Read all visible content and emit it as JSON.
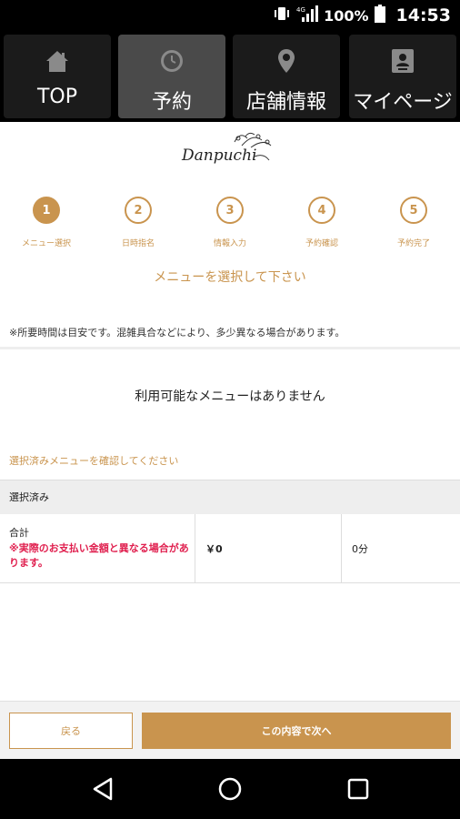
{
  "status_bar": {
    "network": "4G",
    "battery": "100%",
    "time": "14:53"
  },
  "nav": {
    "tabs": [
      {
        "label": "TOP",
        "icon": "home-icon",
        "active": false
      },
      {
        "label": "予約",
        "icon": "clock-icon",
        "active": true
      },
      {
        "label": "店舗情報",
        "icon": "map-pin-icon",
        "active": false
      },
      {
        "label": "マイページ",
        "icon": "profile-card-icon",
        "active": false
      }
    ]
  },
  "logo": {
    "text": "Danpuchi"
  },
  "steps": [
    {
      "number": "1",
      "label": "メニュー選択",
      "active": true
    },
    {
      "number": "2",
      "label": "日時指名",
      "active": false
    },
    {
      "number": "3",
      "label": "情報入力",
      "active": false
    },
    {
      "number": "4",
      "label": "予約確認",
      "active": false
    },
    {
      "number": "5",
      "label": "予約完了",
      "active": false
    }
  ],
  "main": {
    "heading": "メニューを選択して下さい",
    "notice": "※所要時間は目安です。混雑具合などにより、多少異なる場合があります。",
    "empty_message": "利用可能なメニューはありません",
    "confirm_link": "選択済みメニューを確認してください"
  },
  "selected": {
    "header": "選択済み",
    "total_label": "合計",
    "total_note": "※実際のお支払い金額と異なる場合があります。",
    "price": "￥0",
    "duration": "0分"
  },
  "footer": {
    "back_label": "戻る",
    "next_label": "この内容で次へ"
  },
  "colors": {
    "accent": "#c9944e",
    "warning": "#e0204f",
    "nav_background": "#000000",
    "active_tab": "#4a4a4a"
  }
}
